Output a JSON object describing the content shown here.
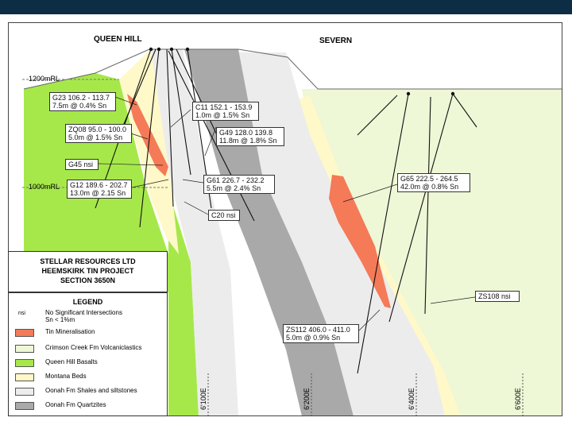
{
  "section_labels": {
    "left": "QUEEN HILL",
    "right": "SEVERN"
  },
  "rl_labels": {
    "upper": "1200mRL",
    "lower": "1000mRL"
  },
  "eastings": [
    "6'100E",
    "6'200E",
    "6'400E",
    "6'600E"
  ],
  "intercepts": {
    "g23": [
      "G23 106.2 - 113.7",
      "7.5m @ 0.4% Sn"
    ],
    "zq08": [
      "ZQ08 95.0 - 100.0",
      "5.0m @ 1.5% Sn"
    ],
    "g45": [
      "G45 nsi"
    ],
    "g12": [
      "G12 189.6 - 202.7",
      "13.0m @ 2.15 Sn"
    ],
    "c11": [
      "C11 152.1 - 153.9",
      "1.0m @ 1.5% Sn"
    ],
    "g49": [
      "G49 128.0 139.8",
      "11.8m @ 1.8% Sn"
    ],
    "g61": [
      "G61 226.7 - 232.2",
      "5.5m @ 2.4% Sn"
    ],
    "c20": [
      "C20 nsi"
    ],
    "g65": [
      "G65 222.5 - 264.5",
      "42.0m @ 0.8% Sn"
    ],
    "zs108": [
      "ZS108 nsi"
    ],
    "zs112": [
      "ZS112 406.0 - 411.0",
      "5.0m @ 0.9% Sn"
    ]
  },
  "title_block": [
    "STELLAR RESOURCES LTD",
    "HEEMSKIRK TIN PROJECT",
    "SECTION 3650N"
  ],
  "legend": {
    "title": "LEGEND",
    "items": [
      {
        "swatch": "nsi",
        "color": "#ffffff",
        "text": [
          "No Significant Intersections",
          "Sn < 1%m"
        ]
      },
      {
        "swatch": "",
        "color": "#f47a58",
        "text": [
          "Tin Mineralisation"
        ]
      },
      {
        "swatch": "",
        "color": "#eef7d6",
        "text": [
          "Crimson Creek Fm Volcaniclastics"
        ]
      },
      {
        "swatch": "",
        "color": "#a6e84a",
        "text": [
          "Queen Hill Basalts"
        ]
      },
      {
        "swatch": "",
        "color": "#fff8c8",
        "text": [
          "Montana Beds"
        ]
      },
      {
        "swatch": "",
        "color": "#ececec",
        "text": [
          "Oonah Fm Shales and siltstones"
        ]
      },
      {
        "swatch": "",
        "color": "#a9a9a9",
        "text": [
          "Oonah Fm Quartzites"
        ]
      }
    ]
  },
  "colors": {
    "header": "#0d2d44",
    "basalt": "#a6e84a",
    "volcaniclastic": "#eef7d6",
    "montana": "#fff8c8",
    "shale": "#ececec",
    "quartzite": "#a9a9a9",
    "tin": "#f47a58"
  }
}
